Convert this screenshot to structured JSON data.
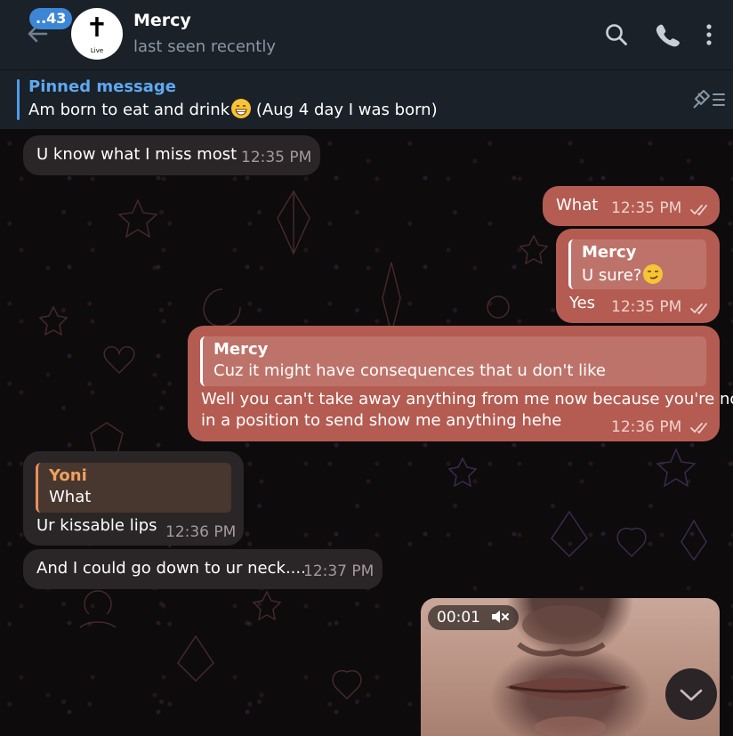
{
  "header": {
    "unread_count": "..43",
    "avatar_caption": "Live",
    "contact_name": "Mercy",
    "status": "last seen recently"
  },
  "pinned": {
    "title": "Pinned message",
    "text": "Am born to eat and drink",
    "text_suffix": " (Aug 4 day I was born)"
  },
  "messages": [
    {
      "dir": "in",
      "text": "U know what I miss most",
      "time": "12:35 PM"
    },
    {
      "dir": "out",
      "text": "What",
      "time": "12:35 PM"
    },
    {
      "dir": "out",
      "reply_to": {
        "name": "Mercy",
        "text": "U sure?"
      },
      "text": "Yes",
      "time": "12:35 PM"
    },
    {
      "dir": "out",
      "reply_to": {
        "name": "Mercy",
        "text": "Cuz it might have consequences that u don't like"
      },
      "text_line1": "Well you can't take away anything from me now because you're not",
      "text_line2": "in a position to send show me anything hehe",
      "time": "12:36 PM"
    },
    {
      "dir": "in",
      "reply_to": {
        "name": "Yoni",
        "text": "What"
      },
      "text": "Ur kissable lips",
      "time": "12:36 PM"
    },
    {
      "dir": "in",
      "text": "And I could go down to ur neck....",
      "time": "12:37 PM"
    }
  ],
  "video": {
    "duration": "00:01",
    "muted": true
  },
  "colors": {
    "outgoing_bubble": "#b45c52",
    "incoming_bubble": "#2a2527",
    "header_bg": "#1a2129",
    "accent": "#3d86d6"
  }
}
